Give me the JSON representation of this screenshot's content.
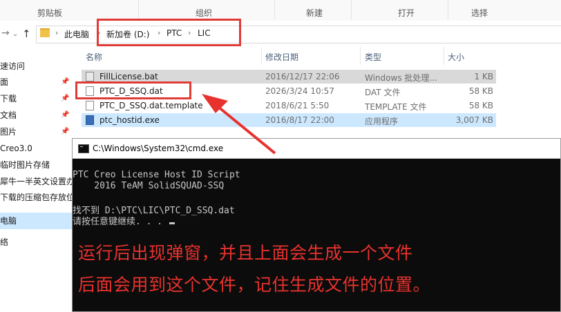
{
  "ribbon": {
    "groups": [
      "剪贴板",
      "组织",
      "新建",
      "打开",
      "选择"
    ]
  },
  "address": {
    "crumbs": [
      "此电脑",
      "新加卷 (D:)",
      "PTC",
      "LIC"
    ]
  },
  "sidebar": {
    "items": [
      {
        "label": "快速访问",
        "pinned": false
      },
      {
        "label": "桌面",
        "pinned": true
      },
      {
        "label": "下载",
        "pinned": true
      },
      {
        "label": "文档",
        "pinned": true
      },
      {
        "label": "图片",
        "pinned": true
      },
      {
        "label": "Creo3.0",
        "pinned": false
      },
      {
        "label": "临时图片存储",
        "pinned": false
      },
      {
        "label": "犀牛一半英文设置办",
        "pinned": false
      },
      {
        "label": "下载的压缩包存放位",
        "pinned": false
      },
      {
        "label": "此电脑",
        "pinned": false,
        "selected": true
      },
      {
        "label": "网络",
        "pinned": false
      }
    ]
  },
  "columns": {
    "name": "名称",
    "date": "修改日期",
    "type": "类型",
    "size": "大小"
  },
  "files": [
    {
      "name": "FillLicense.bat",
      "date": "2016/12/17 22:06",
      "type": "Windows 批处理...",
      "size": "1 KB",
      "icon": "bat-file-icon",
      "state": "highlight"
    },
    {
      "name": "PTC_D_SSQ.dat",
      "date": "2026/3/24 10:57",
      "type": "DAT 文件",
      "size": "58 KB",
      "icon": "file-icon",
      "state": ""
    },
    {
      "name": "PTC_D_SSQ.dat.template",
      "date": "2018/6/21 5:50",
      "type": "TEMPLATE 文件",
      "size": "58 KB",
      "icon": "file-icon",
      "state": ""
    },
    {
      "name": "ptc_hostid.exe",
      "date": "2016/8/17 22:00",
      "type": "应用程序",
      "size": "3,007 KB",
      "icon": "exe-icon",
      "state": "selected"
    }
  ],
  "cmd": {
    "title": "C:\\Windows\\System32\\cmd.exe",
    "lines": [
      "PTC Creo License Host ID Script",
      "    2016 TeAM SolidSQUAD-SSQ",
      "",
      "找不到 D:\\PTC\\LIC\\PTC_D_SSQ.dat",
      "请按任意键继续. . . "
    ]
  },
  "annotation": {
    "line1": "运行后出现弹窗，并且上面会生成一个文件",
    "line2": "后面会用到这个文件，记住生成文件的位置。",
    "color": "#e8322e"
  }
}
